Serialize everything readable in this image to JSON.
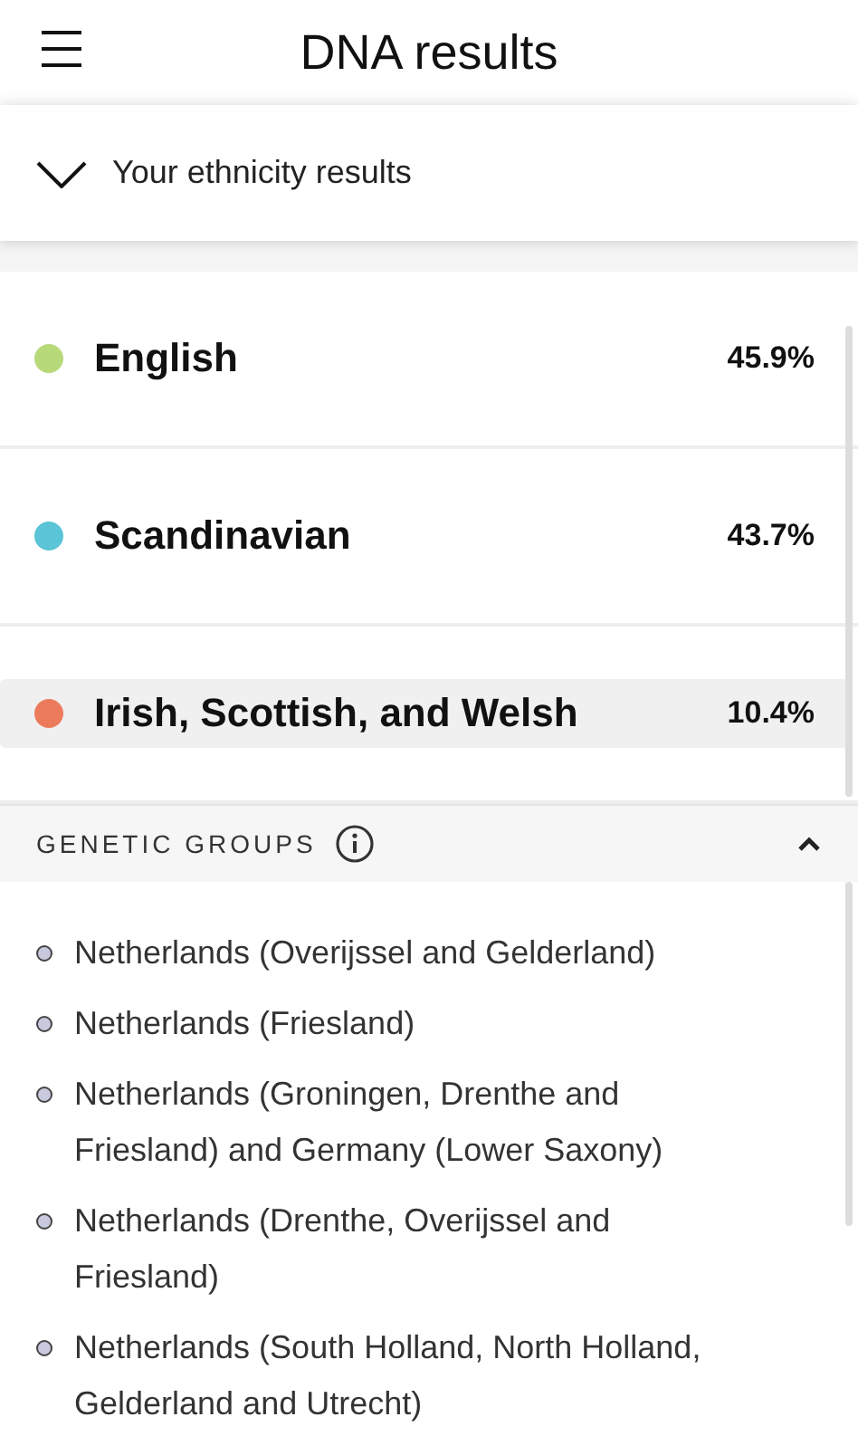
{
  "header": {
    "title": "DNA results"
  },
  "ethnicity_toggle": {
    "label": "Your ethnicity results",
    "expanded": false
  },
  "regions": [
    {
      "name": "English",
      "percent": "45.9%",
      "color": "#b7d97a",
      "selected": false
    },
    {
      "name": "Scandinavian",
      "percent": "43.7%",
      "color": "#5bc4d6",
      "selected": false
    },
    {
      "name": "Irish, Scottish, and Welsh",
      "percent": "10.4%",
      "color": "#ec7b5c",
      "selected": true
    }
  ],
  "genetic_groups": {
    "title": "GENETIC GROUPS",
    "expanded": true,
    "items": [
      "Netherlands (Overijssel and Gelderland)",
      "Netherlands (Friesland)",
      "Netherlands (Groningen, Drenthe and Friesland) and Germany (Lower Saxony)",
      "Netherlands (Drenthe, Overijssel and Friesland)",
      "Netherlands (South Holland, North Holland, Gelderland and Utrecht)"
    ]
  }
}
